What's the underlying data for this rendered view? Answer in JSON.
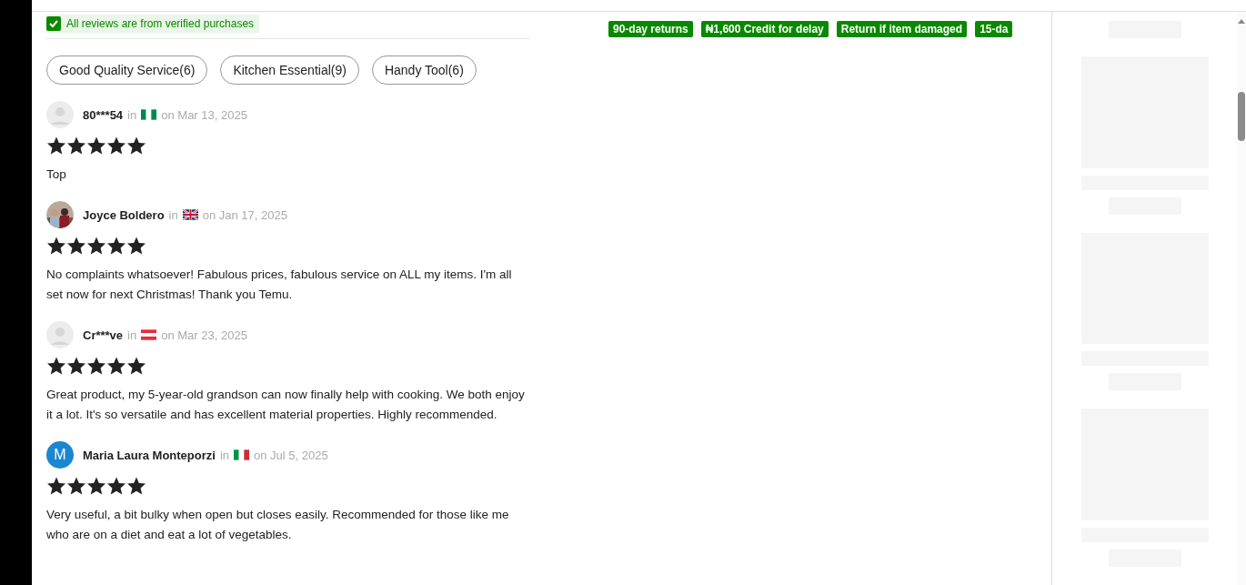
{
  "verified_banner": {
    "text": "All reviews are from verified purchases"
  },
  "tags": [
    {
      "label": "Good Quality Service(6)",
      "selected": false
    },
    {
      "label": "Kitchen Essential(9)",
      "selected": false
    },
    {
      "label": "Handy Tool(6)",
      "selected": false
    }
  ],
  "reviews": [
    {
      "avatar": {
        "kind": "placeholder"
      },
      "name": "80***54",
      "in": "in",
      "flag": {
        "kind": "nigeria"
      },
      "date": "on Mar 13, 2025",
      "stars": 5,
      "text": "Top"
    },
    {
      "name": "Joyce Boldero",
      "in": "in",
      "flag": {
        "kind": "uk"
      },
      "date": "on Jan 17, 2025",
      "stars": 5,
      "text": "No complaints whatsoever! Fabulous prices, fabulous service on ALL my items. I'm all set now for next Christmas! Thank you Temu."
    },
    {
      "avatar": {
        "kind": "placeholder"
      },
      "name": "Cr***ve",
      "in": "in",
      "flag": {
        "kind": "austria"
      },
      "date": "on Mar 23, 2025",
      "stars": 5,
      "text": "Great product, my 5-year-old grandson can now finally help with cooking. We both enjoy it a lot. It's so versatile and has excellent material properties. Highly recommended."
    },
    {
      "avatar": {
        "kind": "letter",
        "letter": "M",
        "color": "#1a86d0"
      },
      "name": "Maria Laura Monteporzi",
      "in": "in",
      "flag": {
        "kind": "italy"
      },
      "date": "on Jul 5, 2025",
      "stars": 5,
      "text": "Very useful, a bit bulky when open but closes easily. Recommended for those like me who are on a diet and eat a lot of vegetables."
    }
  ],
  "badges": [
    "90-day returns",
    "₦1,600 Credit for delay",
    "Return if item damaged",
    "15-da"
  ]
}
